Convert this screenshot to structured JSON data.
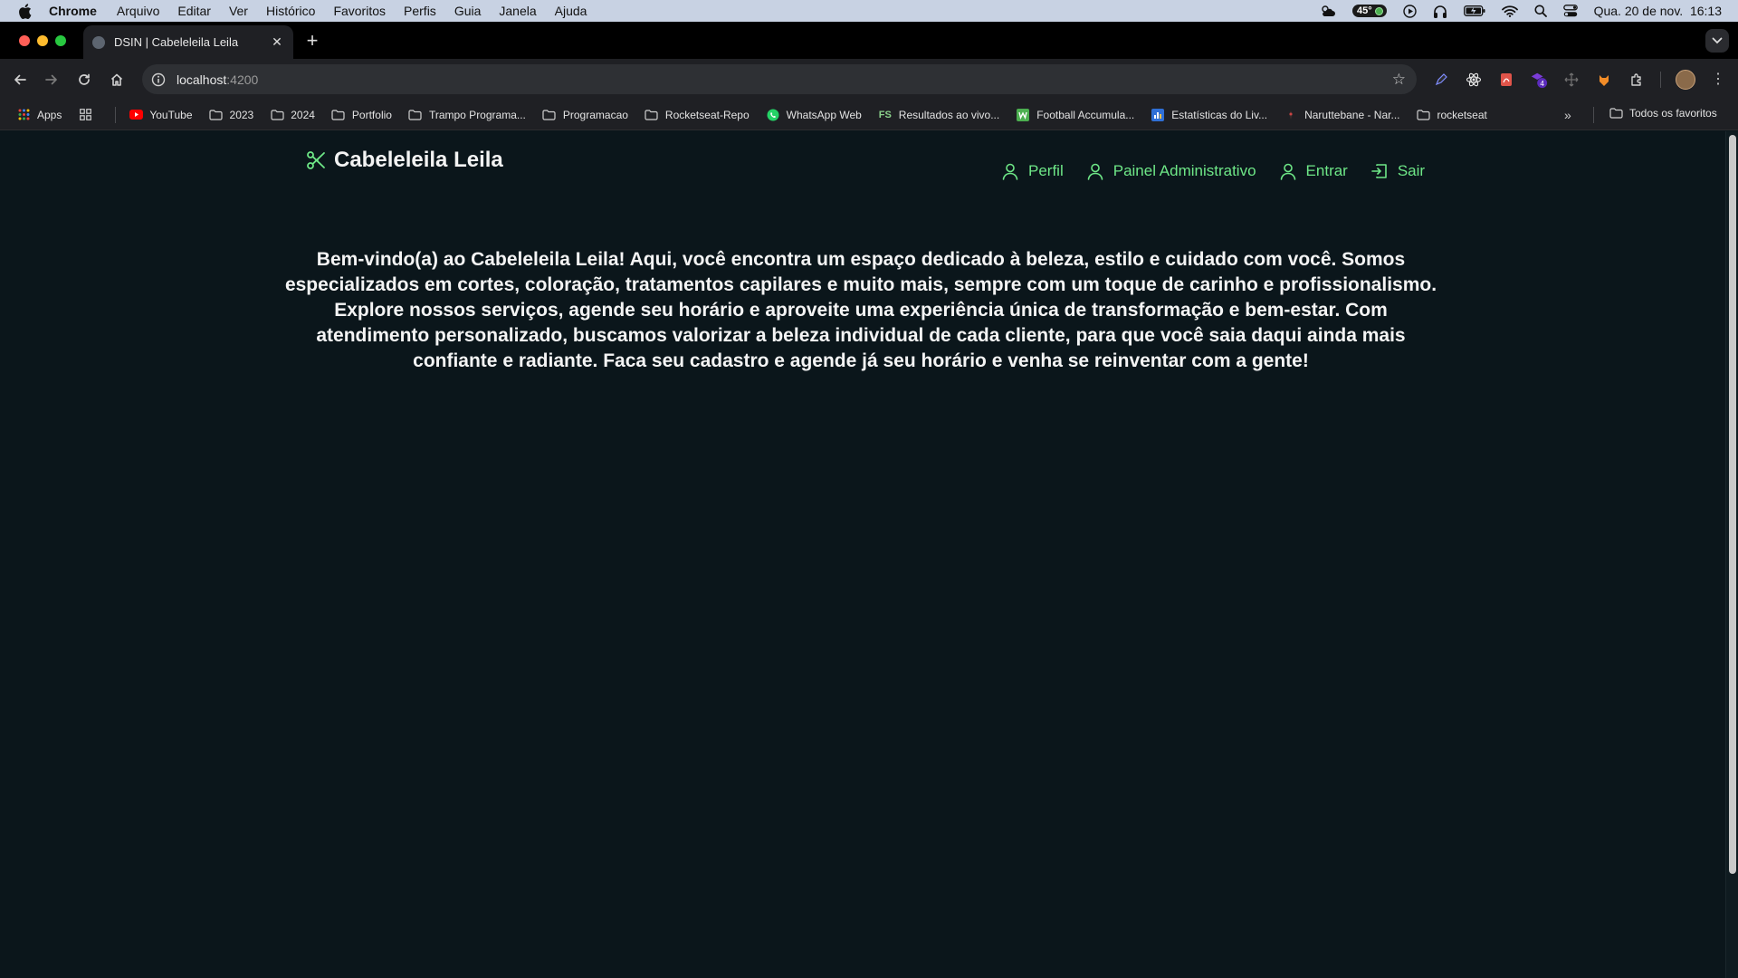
{
  "menubar": {
    "app": "Chrome",
    "items": [
      "Arquivo",
      "Editar",
      "Ver",
      "Histórico",
      "Favoritos",
      "Perfis",
      "Guia",
      "Janela",
      "Ajuda"
    ],
    "temperature": "45°",
    "datetime": "Qua. 20 de nov.  16:13"
  },
  "tab": {
    "title": "DSIN | Cabeleleila Leila"
  },
  "omnibox": {
    "host": "localhost",
    "port": ":4200"
  },
  "extensions": {
    "badge_count": "4"
  },
  "bookmarks": {
    "apps": "Apps",
    "items": [
      {
        "label": "YouTube",
        "icon": "youtube-icon"
      },
      {
        "label": "2023",
        "icon": "folder-icon"
      },
      {
        "label": "2024",
        "icon": "folder-icon"
      },
      {
        "label": "Portfolio",
        "icon": "folder-icon"
      },
      {
        "label": "Trampo Programa...",
        "icon": "folder-icon"
      },
      {
        "label": "Programacao",
        "icon": "folder-icon"
      },
      {
        "label": "Rocketseat-Repo",
        "icon": "folder-icon"
      },
      {
        "label": "WhatsApp Web",
        "icon": "whatsapp-icon"
      },
      {
        "label": "Resultados ao vivo...",
        "icon": "flashscore-icon"
      },
      {
        "label": "Football Accumula...",
        "icon": "football-icon"
      },
      {
        "label": "Estatísticas do Liv...",
        "icon": "stats-icon"
      },
      {
        "label": "Naruttebane - Nar...",
        "icon": "naruto-icon"
      },
      {
        "label": "rocketseat",
        "icon": "folder-icon"
      }
    ],
    "fs_text": "FS",
    "all_favorites": "Todos os favoritos"
  },
  "site": {
    "brand": "Cabeleleila Leila",
    "nav": {
      "profile": "Perfil",
      "admin": "Painel Administrativo",
      "login": "Entrar",
      "logout": "Sair"
    },
    "welcome": "Bem-vindo(a) ao Cabeleleila Leila! Aqui, você encontra um espaço dedicado à beleza, estilo e cuidado com você. Somos especializados em cortes, coloração, tratamentos capilares e muito mais, sempre com um toque de carinho e profissionalismo. Explore nossos serviços, agende seu horário e aproveite uma experiência única de transformação e bem-estar. Com atendimento personalizado, buscamos valorizar a beleza individual de cada cliente, para que você saia daqui ainda mais confiante e radiante. Faca seu cadastro e agende já seu horário e venha se reinventar com a gente!"
  },
  "colors": {
    "page_bg": "#0b161b",
    "accent_green": "#6ee787",
    "menubar_bg": "#c8d2e3",
    "toolbar_bg": "#1f2024"
  }
}
